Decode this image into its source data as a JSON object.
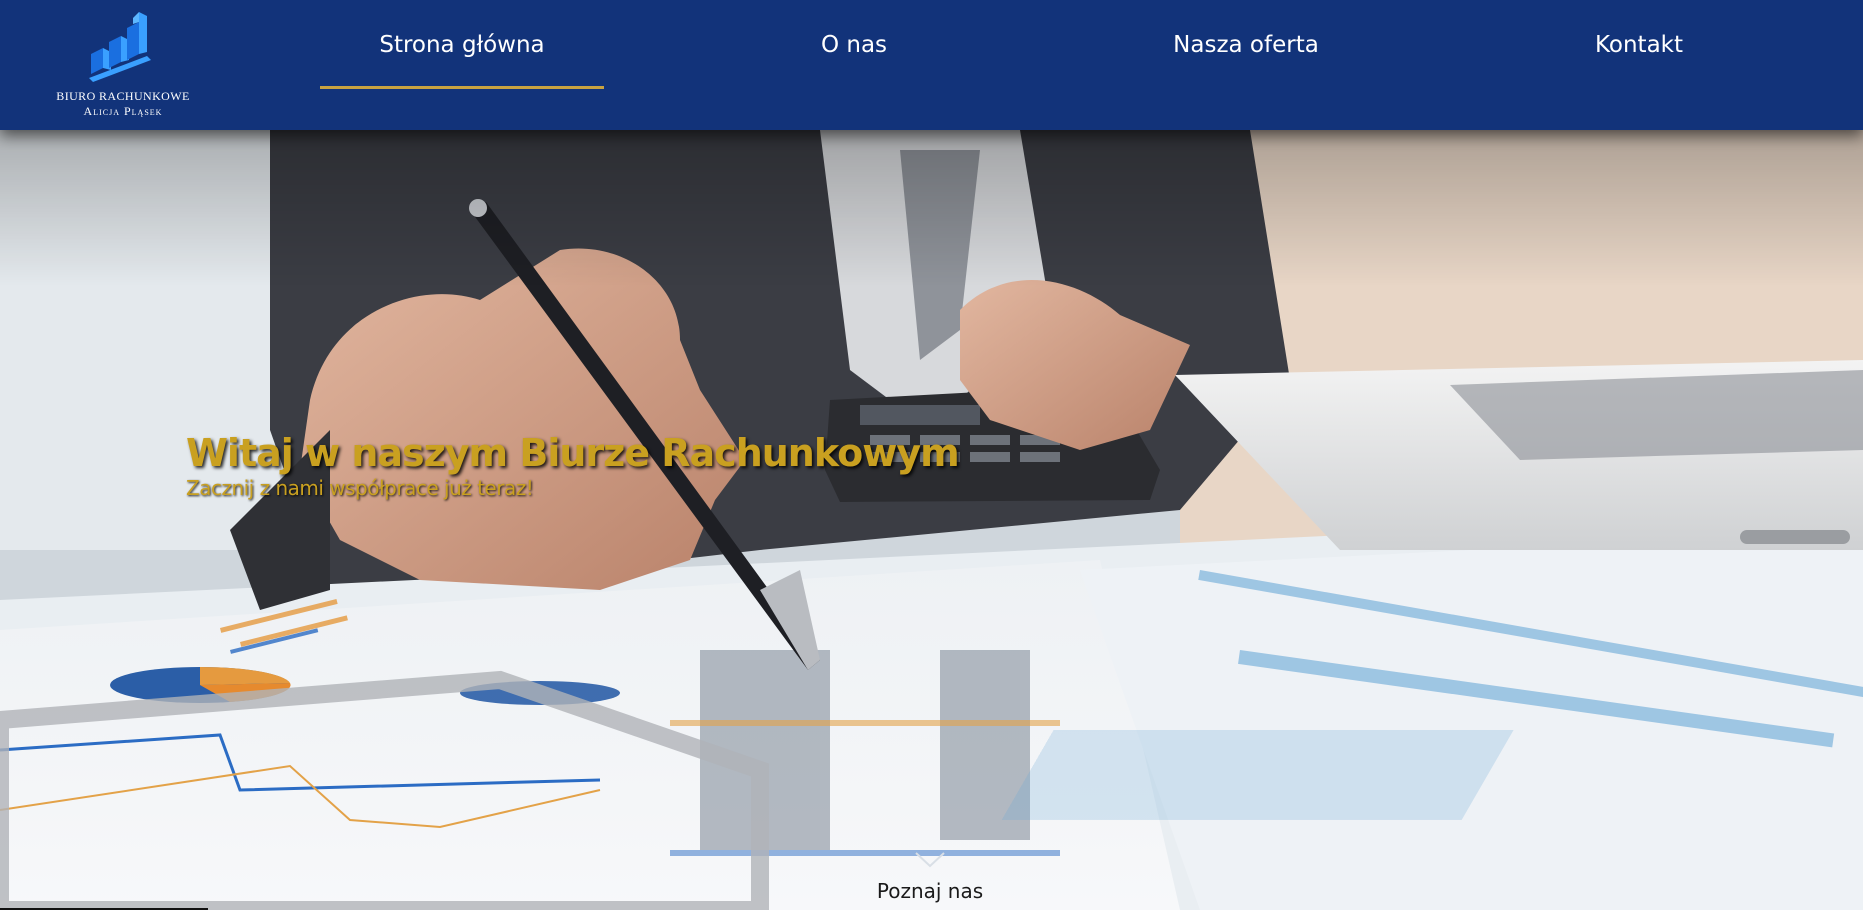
{
  "brand": {
    "line1": "BIURO RACHUNKOWE",
    "line2": "Alicja Pląsek",
    "colors": {
      "bars_light": "#3aa0ff",
      "bars_dark": "#1a6fe0",
      "navbar": "#12337a",
      "accent": "#c9a341"
    }
  },
  "nav": {
    "items": [
      {
        "label": "Strona główna",
        "active": true
      },
      {
        "label": "O nas",
        "active": false
      },
      {
        "label": "Nasza oferta",
        "active": false
      },
      {
        "label": "Kontakt",
        "active": false
      }
    ]
  },
  "hero": {
    "title": "Witaj w naszym Biurze Rachunkowym",
    "subtitle": "Zacznij z nami współprace już teraz!",
    "cta": "Poznaj nas",
    "title_color": "#c9a020",
    "icons": {
      "scroll": "chevron-down-icon",
      "logo": "bar-chart-logo-icon"
    }
  }
}
